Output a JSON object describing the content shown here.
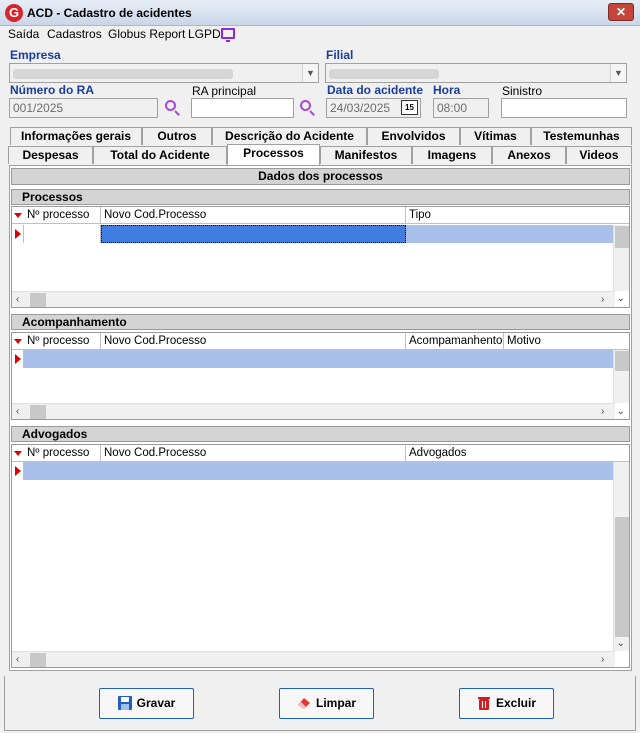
{
  "window": {
    "title": "ACD - Cadastro de acidentes",
    "close": "✕",
    "logo": "G"
  },
  "menu": [
    "Saída",
    "Cadastros",
    "Globus Report",
    "LGPD"
  ],
  "form": {
    "empresa_label": "Empresa",
    "filial_label": "Filial",
    "numero_ra_label": "Número do RA",
    "numero_ra_value": "001/2025",
    "ra_principal_label": "RA principal",
    "ra_principal_value": "",
    "data_label": "Data do acidente",
    "data_value": "24/03/2025",
    "hora_label": "Hora",
    "hora_value": "08:00",
    "sinistro_label": "Sinistro",
    "sinistro_value": "",
    "calendar_glyph": "15"
  },
  "tabs_row1": [
    "Informações gerais",
    "Outros",
    "Descrição do Acidente",
    "Envolvidos",
    "Vítimas",
    "Testemunhas"
  ],
  "tabs_row2": [
    "Despesas",
    "Total do Acidente",
    "Processos",
    "Manifestos",
    "Imagens",
    "Anexos",
    "Videos"
  ],
  "active_tab": "Processos",
  "panel": {
    "header": "Dados dos processos",
    "processos": {
      "title": "Processos",
      "columns": [
        "Nº processo",
        "Novo Cod.Processo",
        "Tipo"
      ]
    },
    "acompanhamento": {
      "title": "Acompanhamento",
      "columns": [
        "Nº processo",
        "Novo Cod.Processo",
        "Acompamanhento",
        "Motivo"
      ]
    },
    "advogados": {
      "title": "Advogados",
      "columns": [
        "Nº processo",
        "Novo Cod.Processo",
        "Advogados"
      ]
    }
  },
  "buttons": {
    "save": "Gravar",
    "clear": "Limpar",
    "delete": "Excluir"
  },
  "colors": {
    "accent": "#1f5fbf",
    "selection": "#a8c0ea",
    "label_blue": "#1a3d9c",
    "search_icon": "#a64bd6"
  }
}
